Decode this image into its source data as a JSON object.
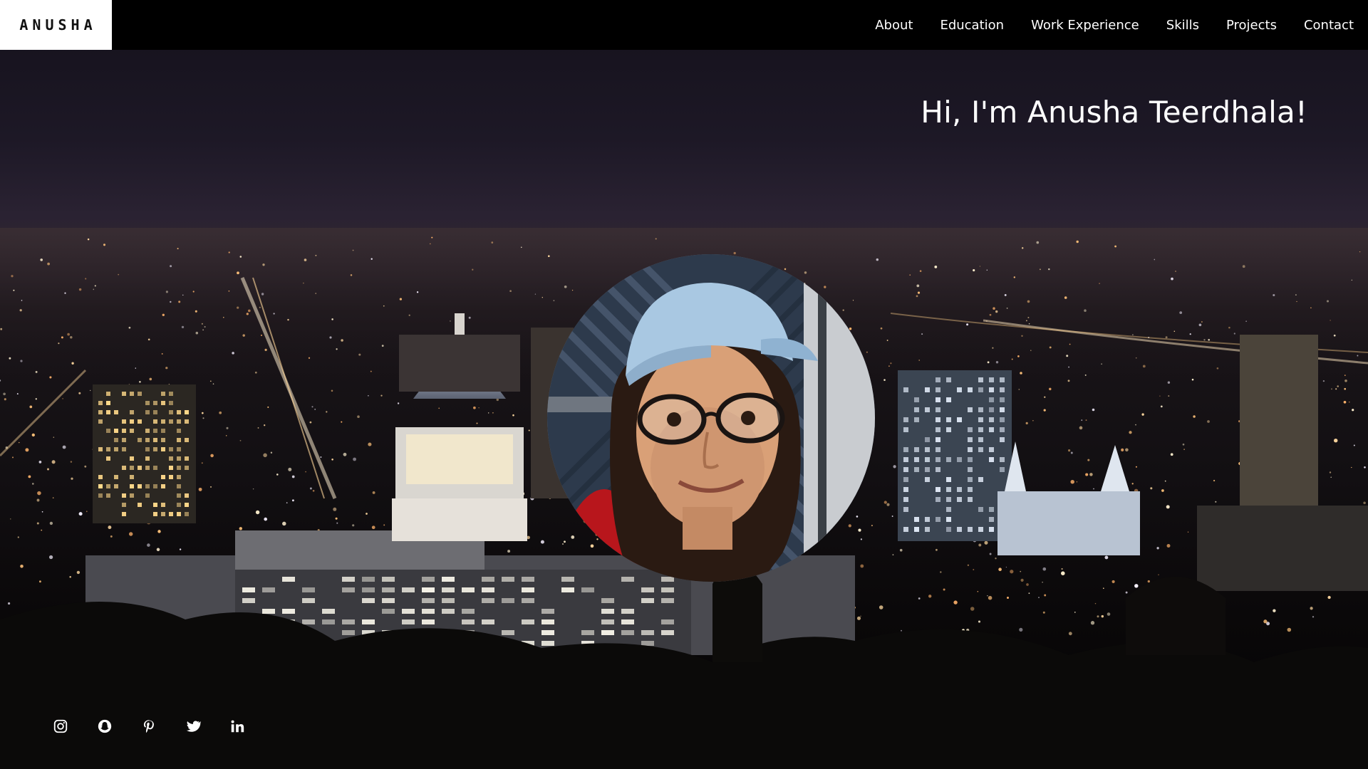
{
  "logo": {
    "text": "ANUSHA"
  },
  "nav": {
    "items": [
      {
        "label": "About"
      },
      {
        "label": "Education"
      },
      {
        "label": "Work Experience"
      },
      {
        "label": "Skills"
      },
      {
        "label": "Projects"
      },
      {
        "label": "Contact"
      }
    ]
  },
  "hero": {
    "greeting": "Hi, I'm Anusha Teerdhala!",
    "background": "night-city-skyline-image",
    "avatar": "profile-photo-avatar"
  },
  "social": {
    "icons": [
      {
        "name": "instagram-icon"
      },
      {
        "name": "snapchat-icon"
      },
      {
        "name": "pinterest-icon"
      },
      {
        "name": "twitter-icon"
      },
      {
        "name": "linkedin-icon"
      }
    ]
  },
  "colors": {
    "nav_background": "#000000",
    "logo_background": "#ffffff",
    "text": "#ffffff"
  }
}
